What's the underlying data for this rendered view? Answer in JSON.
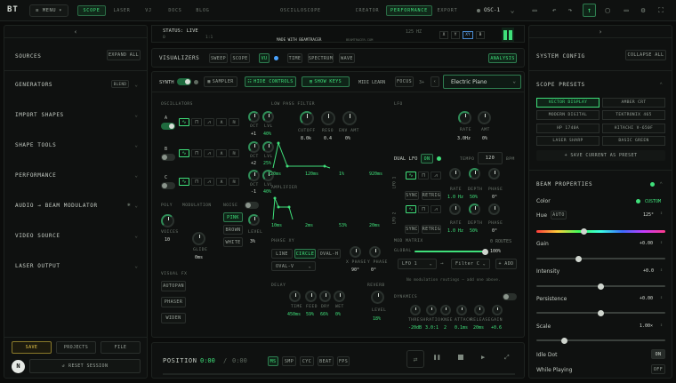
{
  "app": {
    "logo": "BT",
    "menu_label": "MENU"
  },
  "nav": {
    "tabs": [
      "SCOPE",
      "LASER",
      "VJ",
      "DOCS",
      "BLOG"
    ],
    "modes": [
      "OSCILLOSCOPE",
      "CREATOR",
      "PERFORMANCE",
      "EXPORT"
    ],
    "output_label": "OSC-1"
  },
  "status": {
    "text": "STATUS: LIVE",
    "sub_left": "0",
    "sub_right": "1:1",
    "made_with": "MADE WITH BEAMTRACER",
    "url": "BEAMTRACER.COM",
    "fps": "125 HZ",
    "view_buttons": [
      "X",
      "Y",
      "XY",
      "B"
    ],
    "bars_label": "L R"
  },
  "left": {
    "sources_label": "SOURCES",
    "expand_all": "EXPAND ALL",
    "sections": [
      "GENERATORS",
      "IMPORT SHAPES",
      "SHAPE TOOLS",
      "PERFORMANCE",
      "AUDIO → BEAM MODULATOR",
      "VIDEO SOURCE",
      "LASER OUTPUT"
    ],
    "blend": "BLEND",
    "save": "SAVE",
    "projects": "PROJECTS",
    "file": "FILE",
    "reset": "RESET SESSION",
    "avatar": "N"
  },
  "viz": {
    "label": "VISUALIZERS",
    "tabs": [
      "SWEEP",
      "SCOPE",
      "VU",
      "TIME",
      "SPECTRUM",
      "WAVE"
    ],
    "analysis": "ANALYSIS",
    "synth": "SYNTH",
    "sampler": "SAMPLER",
    "hide_controls": "HIDE CONTROLS",
    "show_keys": "SHOW KEYS",
    "midi_learn": "MIDI LEARN",
    "focus": "FOCUS",
    "octave": "3+",
    "preset": "Electric Piano"
  },
  "osc": {
    "label": "OSCILLATORS",
    "rows": [
      "A",
      "B",
      "C"
    ],
    "oct_label": "OCT",
    "lvl_label": "LVL",
    "oct_values": [
      "+1",
      "+2",
      "-1"
    ],
    "lvl_values": [
      "40%",
      "25%",
      "40%"
    ],
    "poly": "POLY",
    "modulation": "MODULATION",
    "voices_label": "VOICES",
    "voices": "10",
    "glide_label": "GLIDE",
    "glide": "0ms",
    "noise": "NOISE",
    "noise_types": [
      "PINK",
      "BROWN",
      "WHITE"
    ],
    "level_label": "LEVEL",
    "level": "3%"
  },
  "visual_fx": {
    "label": "VISUAL FX",
    "items": [
      "AUTOPAN",
      "PHASER",
      "WIDEN"
    ]
  },
  "filter": {
    "label": "LOW PASS FILTER",
    "knobs": [
      {
        "label": "CUTOFF",
        "value": "8.0k"
      },
      {
        "label": "RESO",
        "value": "0.4"
      },
      {
        "label": "ENV AMT",
        "value": "0%"
      }
    ],
    "amp_label": "AMPLIFIER",
    "env_vals": [
      "120ms",
      "120ms",
      "1%",
      "920ms"
    ],
    "amp_vals": [
      "10ms",
      "2ms",
      "53%",
      "20ms"
    ]
  },
  "phase": {
    "label": "PHASE XY",
    "modes": [
      "LINE",
      "CIRCLE",
      "OVAL-H"
    ],
    "select": "OVAL-V",
    "x_phase_label": "X PHASE",
    "y_phase_label": "Y PHASE",
    "x_phase": "90°",
    "y_phase": "0°"
  },
  "delay": {
    "label": "DELAY",
    "knobs": [
      {
        "label": "TIME",
        "value": "450ms"
      },
      {
        "label": "FEED",
        "value": "59%"
      },
      {
        "label": "DRY",
        "value": "66%"
      },
      {
        "label": "WET",
        "value": "0%"
      }
    ],
    "reverb_label": "REVERB",
    "reverb_level_label": "LEVEL",
    "reverb_level": "18%"
  },
  "lfo": {
    "label": "LFO",
    "rate_label": "RATE",
    "amt_label": "AMT",
    "rate": "3.0Hz",
    "amt": "0%",
    "dual_label": "DUAL LFO",
    "dual_on": "ON",
    "tempo_label": "TEMPO",
    "tempo": "120",
    "bpm": "BPM",
    "lfo1": "LFO 1",
    "lfo2": "LFO 2",
    "sync": "SYNC",
    "retrig": "RETRIG",
    "lfo_knobs": [
      {
        "label": "RATE",
        "v1": "1.0 Hz",
        "v2": "1.0 Hz"
      },
      {
        "label": "DEPTH",
        "v1": "50%",
        "v2": "50%"
      },
      {
        "label": "PHASE",
        "v1": "0°",
        "v2": "0°"
      }
    ]
  },
  "mod": {
    "label": "MOD MATRIX",
    "routes": "0 ROUTES",
    "global_label": "GLOBAL",
    "global": "100%",
    "source": "LFO 1",
    "target": "Filter C",
    "add": "+ ADD",
    "empty": "No modulation routings — add one above."
  },
  "dyn": {
    "label": "DYNAMICS",
    "knobs": [
      {
        "label": "THRESH",
        "value": "-20dB"
      },
      {
        "label": "RATIO",
        "value": "3.0:1"
      },
      {
        "label": "KNEE",
        "value": "2"
      },
      {
        "label": "ATTACK",
        "value": "0.1ms"
      },
      {
        "label": "RELEASE",
        "value": "20ms"
      },
      {
        "label": "GAIN",
        "value": "+0.6"
      }
    ]
  },
  "transport": {
    "label": "POSITION",
    "time": "0:00",
    "total": "0:00",
    "modes": [
      "MS",
      "SMP",
      "CYC",
      "BEAT",
      "FPS"
    ]
  },
  "right": {
    "system": "SYSTEM CONFIG",
    "collapse": "COLLAPSE ALL",
    "presets_label": "SCOPE PRESETS",
    "presets": [
      "VECTOR DISPLAY",
      "AMBER CRT",
      "MODERN DIGITAL",
      "TEKTRONIX 465",
      "HP 1740A",
      "HITACHI V-650F",
      "LASER SHARP",
      "BASIC GREEN"
    ],
    "save_preset": "+ SAVE CURRENT AS PRESET",
    "beam_label": "BEAM PROPERTIES",
    "color_label": "Color",
    "custom": "CUSTOM",
    "hue_label": "Hue",
    "auto": "AUTO",
    "hue_value": "125°",
    "props": [
      {
        "label": "Gain",
        "value": "+0.00",
        "pos": 0.32
      },
      {
        "label": "Intensity",
        "value": "+0.0",
        "pos": 0.5
      },
      {
        "label": "Persistence",
        "value": "+0.00",
        "pos": 0.5
      },
      {
        "label": "Scale",
        "value": "1.00×",
        "pos": 0.2
      }
    ],
    "idle_dot": "Idle Dot",
    "idle_on": "ON",
    "while_playing": "While Playing",
    "while_off": "OFF"
  },
  "colors": {
    "accent": "#3fe07a",
    "bg": "#0b0c0b",
    "panel": "#0f1110"
  }
}
